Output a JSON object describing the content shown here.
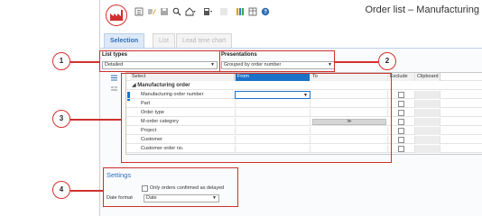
{
  "window": {
    "title": "Order list – Manufacturing"
  },
  "toolbar": {
    "icons": [
      "list-icon",
      "filter-edit-icon",
      "save-icon",
      "search-icon",
      "home-icon",
      "dropdown-icon",
      "calculator-icon",
      "dropdown-icon",
      "grid-icon",
      "grid-columns-icon",
      "help-icon"
    ]
  },
  "tabs": [
    {
      "label": "Selection",
      "active": true
    },
    {
      "label": "List",
      "active": false
    },
    {
      "label": "Lead time chart",
      "active": false
    }
  ],
  "list_types": {
    "heading": "List types",
    "value": "Detailed"
  },
  "presentations": {
    "heading": "Presentations",
    "value": "Grouped by order number"
  },
  "grid": {
    "columns": {
      "select": "Select",
      "from": "From",
      "to": "To",
      "exclude": "Exclude",
      "clipboard": "Clipboard"
    },
    "group": "Manufacturing order",
    "rows": [
      {
        "label": "Manufacturing order number"
      },
      {
        "label": "Part"
      },
      {
        "label": "Order type"
      },
      {
        "label": "M-order category",
        "to_button": "≫"
      },
      {
        "label": "Project"
      },
      {
        "label": "Customer"
      },
      {
        "label": "Customer order no."
      }
    ]
  },
  "settings": {
    "title": "Settings",
    "checkbox_label": "Only orders confirmed as delayed",
    "date_format_label": "Date format",
    "date_format_value": "Date"
  },
  "callouts": {
    "c1": "1",
    "c2": "2",
    "c3": "3",
    "c4": "4"
  },
  "colors": {
    "accent": "#1b73c9",
    "callout_red": "#d0312d",
    "tab_active_text": "#2e6fb8"
  }
}
